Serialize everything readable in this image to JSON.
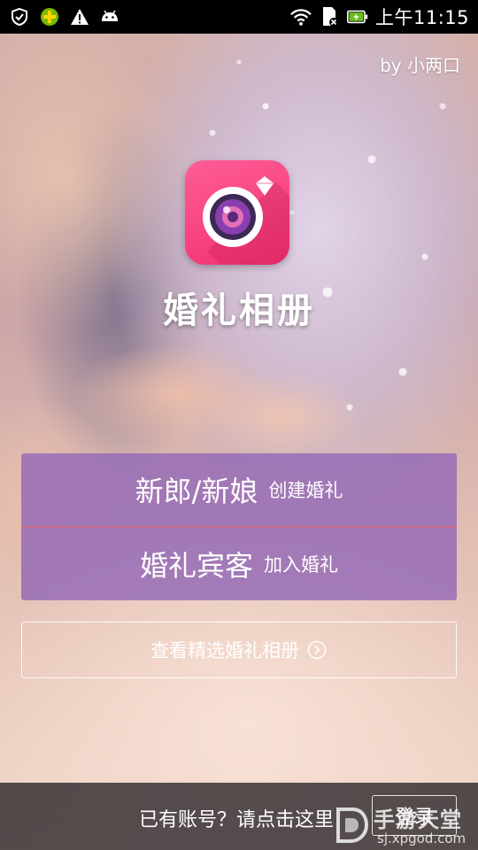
{
  "status_bar": {
    "time": "上午11:15",
    "left_icons": [
      "shield-check-icon",
      "plus-badge-icon",
      "warning-icon",
      "android-icon"
    ],
    "right_icons": [
      "wifi-icon",
      "sd-card-icon",
      "battery-charging-icon"
    ]
  },
  "header": {
    "credit": "by 小两口"
  },
  "app": {
    "title": "婚礼相册",
    "icon": "camera-ring-icon",
    "icon_color": "#f23a78"
  },
  "actions": {
    "couple": {
      "primary": "新郎/新娘",
      "secondary": "创建婚礼"
    },
    "guest": {
      "primary": "婚礼宾客",
      "secondary": "加入婚礼"
    },
    "panel_color": "#966cb6"
  },
  "browse": {
    "label": "查看精选婚礼相册",
    "icon": "chevron-right-circle-icon"
  },
  "footer": {
    "prompt": "已有账号？请点击这里",
    "login_label": "登录"
  },
  "watermark": {
    "brand": "手游天堂",
    "site": "sj.xpgod.com"
  }
}
